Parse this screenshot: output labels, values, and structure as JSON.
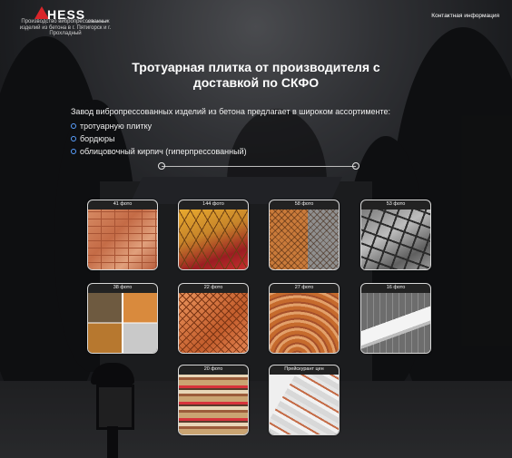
{
  "header": {
    "logo_text": "HESS",
    "logo_sub": "GROUP",
    "tagline": "Производство вибропрессованных изделий из бетона в г. Пятигорск и г. Прохладный",
    "contact_link": "Контактная информация"
  },
  "hero": {
    "title": "Тротуарная плитка от производителя с доставкой по СКФО",
    "intro": "Завод вибропрессованных изделий из бетона предлагает в широком ассортименте:",
    "items": [
      "тротуарную плитку",
      "бордюры",
      "облицовочный кирпич (гиперпрессованный)"
    ]
  },
  "gallery": [
    {
      "label": "41 фото",
      "image": "paving-tiles-red"
    },
    {
      "label": "144 фото",
      "image": "paving-tiles-yellow-red"
    },
    {
      "label": "58 фото",
      "image": "paving-tiles-orange-grey"
    },
    {
      "label": "53 фото",
      "image": "paving-tiles-grey"
    },
    {
      "label": "38 фото",
      "image": "paving-tiles-mixed"
    },
    {
      "label": "22 фото",
      "image": "paving-tiles-orange-wave"
    },
    {
      "label": "27 фото",
      "image": "paving-circle-pattern"
    },
    {
      "label": "16 фото",
      "image": "curbs"
    },
    {
      "label": "20 фото",
      "image": "facing-bricks"
    },
    {
      "label": "Прейскурант цен",
      "image": "price-list"
    }
  ],
  "colors": {
    "brand_red": "#d9252a",
    "bullet_blue": "#5aa0ff"
  }
}
